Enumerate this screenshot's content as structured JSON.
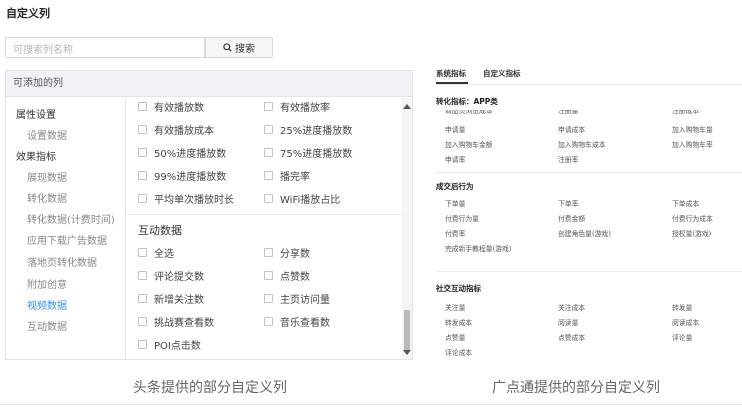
{
  "left": {
    "title": "自定义列",
    "search": {
      "placeholder": "可搜索列名称",
      "button": "搜索"
    },
    "panel_header": "可添加的列",
    "nav": [
      {
        "label": "属性设置",
        "kind": "group"
      },
      {
        "label": "设置数据",
        "kind": "sub"
      },
      {
        "label": "效果指标",
        "kind": "group"
      },
      {
        "label": "展现数据",
        "kind": "sub"
      },
      {
        "label": "转化数据",
        "kind": "sub"
      },
      {
        "label": "转化数据(计费时间)",
        "kind": "sub"
      },
      {
        "label": "应用下载广告数据",
        "kind": "sub"
      },
      {
        "label": "落地页转化数据",
        "kind": "sub"
      },
      {
        "label": "附加创意",
        "kind": "sub"
      },
      {
        "label": "视频数据",
        "kind": "active"
      },
      {
        "label": "互动数据",
        "kind": "sub"
      }
    ],
    "video_options": [
      "有效播放数",
      "有效播放率",
      "有效播放成本",
      "25%进度播放数",
      "50%进度播放数",
      "75%进度播放数",
      "99%进度播放数",
      "播完率",
      "平均单次播放时长",
      "WiFi播放占比"
    ],
    "interaction_title": "互动数据",
    "interaction_options": [
      "全选",
      "分享数",
      "评论提交数",
      "点赞数",
      "新增关注数",
      "主页访问量",
      "挑战赛查看数",
      "音乐查看数",
      "POI点击数"
    ]
  },
  "right": {
    "tabs": [
      "系统指标",
      "自定义指标"
    ],
    "conversion_title": "转化指标：APP类",
    "conversion_partial": [
      "商品页浏览成本",
      "注册量",
      "注册成本"
    ],
    "conversion_items": [
      "申请量",
      "申请成本",
      "加入购物车量",
      "加入购物车金额",
      "加入购物车成本",
      "加入购物车率",
      "申请率",
      "注册率"
    ],
    "after_title": "成交后行为",
    "after_items": [
      "下单量",
      "下单率",
      "下单成本",
      "付费行为量",
      "付费金额",
      "付费行为成本",
      "付费率",
      "创建角色量(游戏)",
      "授权量(游戏)",
      "完成新手教程量(游戏)"
    ],
    "social_title": "社交互动指标",
    "social_items": [
      "关注量",
      "关注成本",
      "转发量",
      "转发成本",
      "阅读量",
      "阅读成本",
      "点赞量",
      "点赞成本",
      "评论量",
      "评论成本"
    ]
  },
  "captions": {
    "left": "头条提供的部分自定义列",
    "right": "广点通提供的部分自定义列"
  },
  "colors": {
    "active_nav": "#3a8ee6",
    "panel_header_bg": "#f0f2f5"
  },
  "icons": {
    "search_button": "search-icon"
  }
}
